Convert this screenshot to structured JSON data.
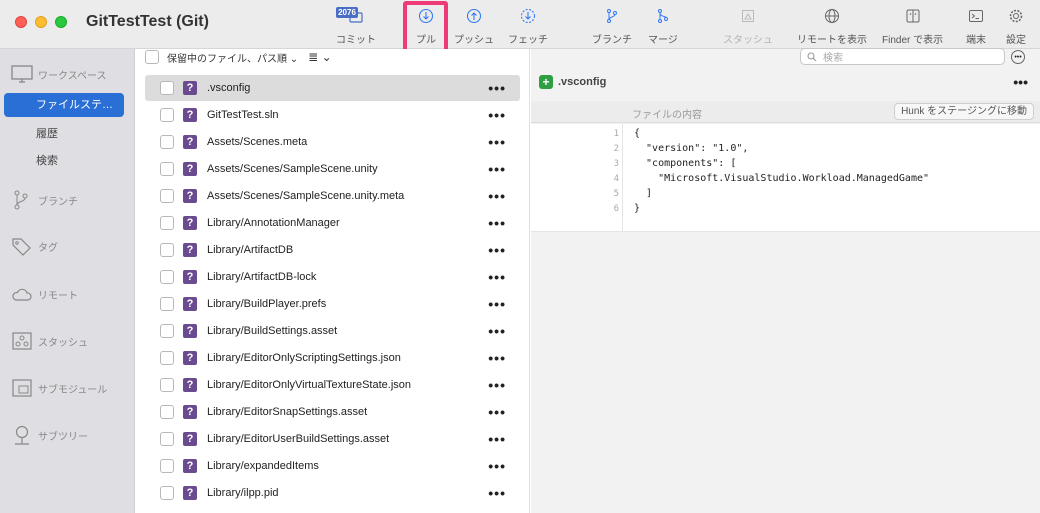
{
  "window": {
    "title": "GitTestTest (Git)"
  },
  "toolbar": {
    "commit_badge": "2076",
    "buttons": [
      {
        "label": "コミット"
      },
      {
        "label": "プル"
      },
      {
        "label": "プッシュ"
      },
      {
        "label": "フェッチ"
      },
      {
        "label": "ブランチ"
      },
      {
        "label": "マージ"
      },
      {
        "label": "スタッシュ"
      },
      {
        "label": "リモートを表示"
      },
      {
        "label": "Finder で表示"
      },
      {
        "label": "端末"
      },
      {
        "label": "設定"
      }
    ]
  },
  "sidebar": {
    "workspace": "ワークスペース",
    "file_status": "ファイルステ…",
    "history": "履歴",
    "search": "検索",
    "branches": "ブランチ",
    "tags": "タグ",
    "remotes": "リモート",
    "stashes": "スタッシュ",
    "submodules": "サブモジュール",
    "subtrees": "サブツリー"
  },
  "filelist": {
    "sort_label": "保留中のファイル、パス順",
    "files": [
      ".vsconfig",
      "GitTestTest.sln",
      "Assets/Scenes.meta",
      "Assets/Scenes/SampleScene.unity",
      "Assets/Scenes/SampleScene.unity.meta",
      "Library/AnnotationManager",
      "Library/ArtifactDB",
      "Library/ArtifactDB-lock",
      "Library/BuildPlayer.prefs",
      "Library/BuildSettings.asset",
      "Library/EditorOnlyScriptingSettings.json",
      "Library/EditorOnlyVirtualTextureState.json",
      "Library/EditorSnapSettings.asset",
      "Library/EditorUserBuildSettings.asset",
      "Library/expandedItems",
      "Library/ilpp.pid"
    ]
  },
  "search": {
    "placeholder": "検索"
  },
  "diff": {
    "filename": ".vsconfig",
    "content_label": "ファイルの内容",
    "hunk_button": "Hunk をステージングに移動",
    "lines": [
      {
        "num": "1",
        "text": "{"
      },
      {
        "num": "2",
        "text": "  \"version\": \"1.0\","
      },
      {
        "num": "3",
        "text": "  \"components\": ["
      },
      {
        "num": "4",
        "text": "    \"Microsoft.VisualStudio.Workload.ManagedGame\""
      },
      {
        "num": "5",
        "text": "  ]"
      },
      {
        "num": "6",
        "text": "}"
      }
    ]
  }
}
